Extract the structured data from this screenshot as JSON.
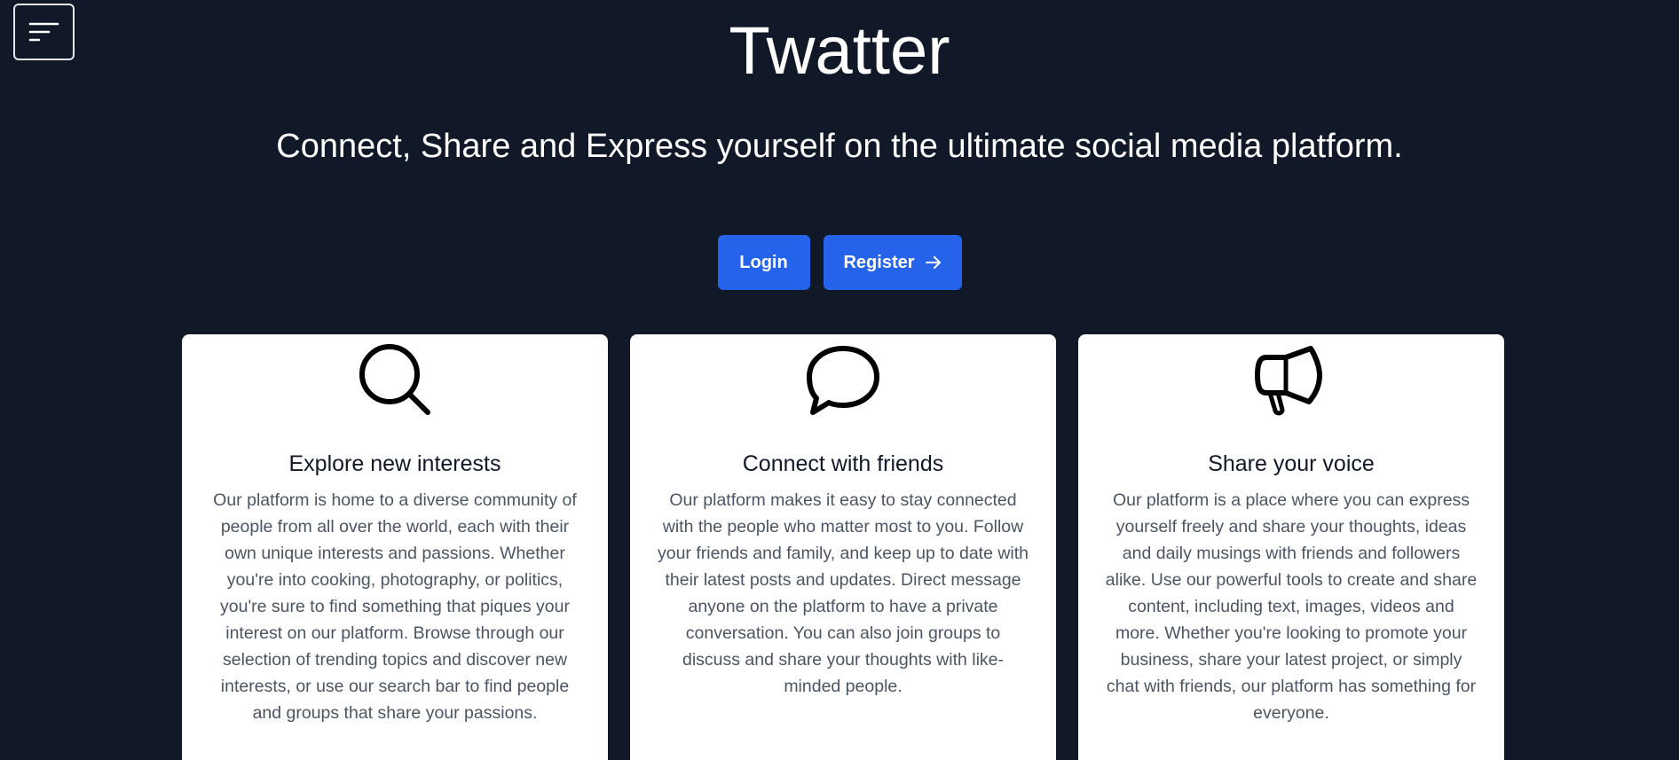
{
  "header": {
    "menu_icon": "menu-lines-icon"
  },
  "hero": {
    "title": "Twatter",
    "subtitle": "Connect, Share and Express yourself on the ultimate social media platform."
  },
  "actions": {
    "login_label": "Login",
    "register_label": "Register",
    "register_icon": "arrow-right-icon"
  },
  "colors": {
    "background": "#111827",
    "primary": "#2563eb",
    "card": "#ffffff"
  },
  "features": [
    {
      "icon": "magnifier-icon",
      "title": "Explore new interests",
      "text": "Our platform is home to a diverse community of people from all over the world, each with their own unique interests and passions. Whether you're into cooking, photography, or politics, you're sure to find something that piques your interest on our platform. Browse through our selection of trending topics and discover new interests, or use our search bar to find people and groups that share your passions."
    },
    {
      "icon": "speech-bubble-icon",
      "title": "Connect with friends",
      "text": "Our platform makes it easy to stay connected with the people who matter most to you. Follow your friends and family, and keep up to date with their latest posts and updates. Direct message anyone on the platform to have a private conversation. You can also join groups to discuss and share your thoughts with like-minded people."
    },
    {
      "icon": "megaphone-icon",
      "title": "Share your voice",
      "text": "Our platform is a place where you can express yourself freely and share your thoughts, ideas and daily musings with friends and followers alike. Use our powerful tools to create and share content, including text, images, videos and more. Whether you're looking to promote your business, share your latest project, or simply chat with friends, our platform has something for everyone."
    }
  ]
}
